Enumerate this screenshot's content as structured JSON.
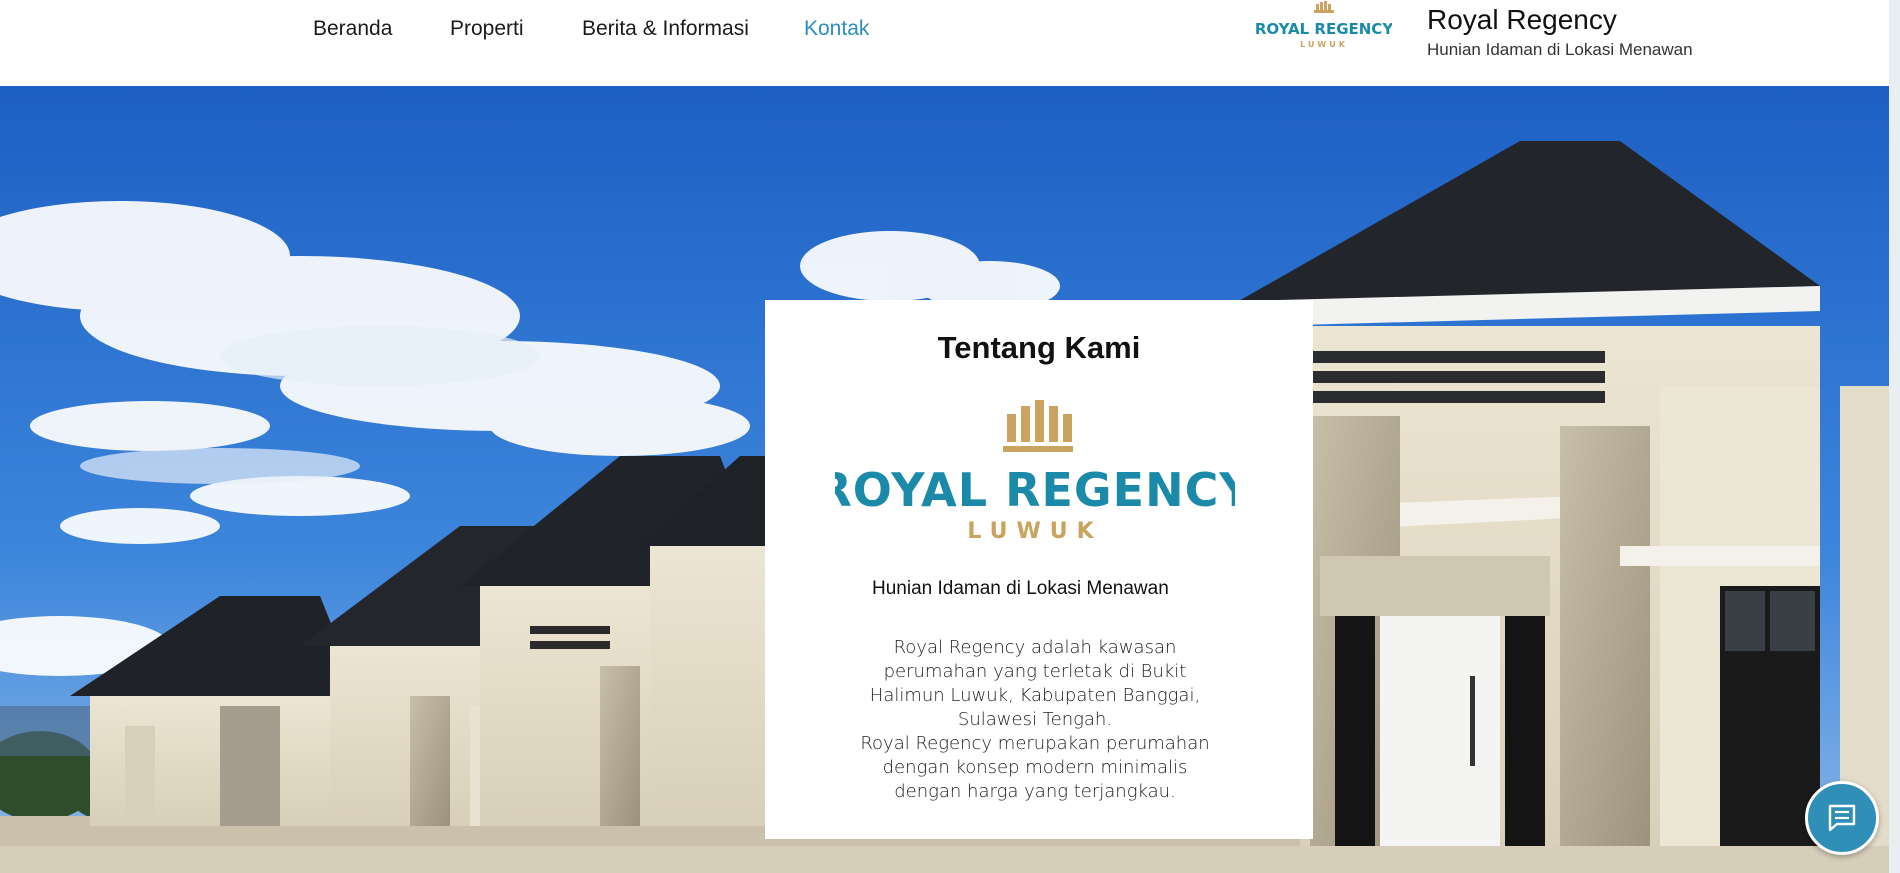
{
  "nav": {
    "items": [
      {
        "label": "Beranda",
        "active": false
      },
      {
        "label": "Properti",
        "active": false
      },
      {
        "label": "Berita & Informasi",
        "active": false
      },
      {
        "label": "Kontak",
        "active": true
      }
    ]
  },
  "brand": {
    "name": "Royal Regency",
    "tagline": "Hunian Idaman di Lokasi Menawan",
    "logo_text_main": "ROYAL REGENCY",
    "logo_text_sub": "LUWUK"
  },
  "about": {
    "title": "Tentang Kami",
    "tagline": "Hunian Idaman di Lokasi Menawan",
    "description_lines": [
      "Royal Regency adalah kawasan perumahan yang terletak di Bukit Halimun Luwuk, Kabupaten Banggai, Sulawesi Tengah.",
      "Royal Regency merupakan perumahan dengan konsep modern minimalis dengan harga yang terjangkau."
    ]
  },
  "chat": {
    "icon": "chat-icon"
  },
  "colors": {
    "accent": "#2b8fb8",
    "logo_teal": "#1a8aa8",
    "logo_gold": "#c9a35f",
    "sky": "#2a6fcf"
  }
}
